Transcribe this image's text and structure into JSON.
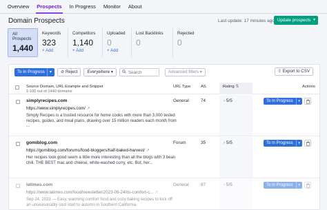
{
  "tabs": [
    {
      "label": "Overview"
    },
    {
      "label": "Prospects"
    },
    {
      "label": "In Progress"
    },
    {
      "label": "Monitor"
    },
    {
      "label": "About"
    }
  ],
  "page_title": "Domain Prospects",
  "last_update": "Last update: 17 minutes ago",
  "update_button": "Update prospects",
  "stats": [
    {
      "label": "All Prospects",
      "value": "1,440",
      "add": ""
    },
    {
      "label": "Keywords",
      "value": "323",
      "add": "+ Add"
    },
    {
      "label": "Competitors",
      "value": "1,140",
      "add": "+ Add"
    },
    {
      "label": "Uploaded",
      "value": "0",
      "add": "+ Add"
    },
    {
      "label": "Lost Backlinks",
      "value": "0",
      "add": ""
    },
    {
      "label": "Rejected",
      "value": "0",
      "add": ""
    }
  ],
  "toolbar": {
    "to_in_progress": "To In Progress",
    "reject": "Reject",
    "scope_select": "Everywhere",
    "search_placeholder": "Search",
    "advanced_filters": "Advanced filters",
    "export": "Export to CSV"
  },
  "table": {
    "col_source": "Source Domain, URL Example and Snippet",
    "col_source_sub": "1-100 out of 1440 domains",
    "col_type": "URL Type",
    "col_as": "AS",
    "col_rating": "Rating",
    "col_actions": "Actions",
    "rows": [
      {
        "domain": "simplyrecipes.com",
        "url": "https://www.simplyrecipes.com/",
        "snippet": "Simply Recipes is a trusted resource for home cooks with more than 3,000 tested recipes, guides, and meal plans, drawing over 15 million readers each month from ...",
        "type": "General",
        "as": "74",
        "rating": "5/5",
        "action": "To In Progress"
      },
      {
        "domain": "gomiblog.com",
        "url": "https://gomiblog.com/forums/food-bloggers/half-baked-harvest/",
        "snippet": "Her recipes look good seem a little more interesting than all the blogs with 3 bean chili, THE BEST mac and cheese, white-washed curry, etc. But, her...",
        "type": "Forum",
        "as": "35",
        "rating": "5/5",
        "action": "To In Progress"
      },
      {
        "domain": "latimes.com",
        "url": "https://www.latimes.com/food/newsletter/2023-09-24/its-comfort-c...",
        "snippet": "Sep 24, 2023 — Easy, warming comfort food and cozy baking recipes to kick off an unseasonably cool start to autumn in Southern California.",
        "type": "General",
        "as": "87",
        "rating": "5/5",
        "action": "To In Progress"
      }
    ]
  },
  "colors": {
    "accent_purple": "#6c1ec5",
    "primary_blue": "#2e6fe0",
    "update_green": "#009f81"
  },
  "icons": [
    "external-link-icon",
    "reject-icon",
    "search-icon",
    "export-icon",
    "sort-icon",
    "chevron-down-icon",
    "trash-icon",
    "chevron-right-icon"
  ]
}
